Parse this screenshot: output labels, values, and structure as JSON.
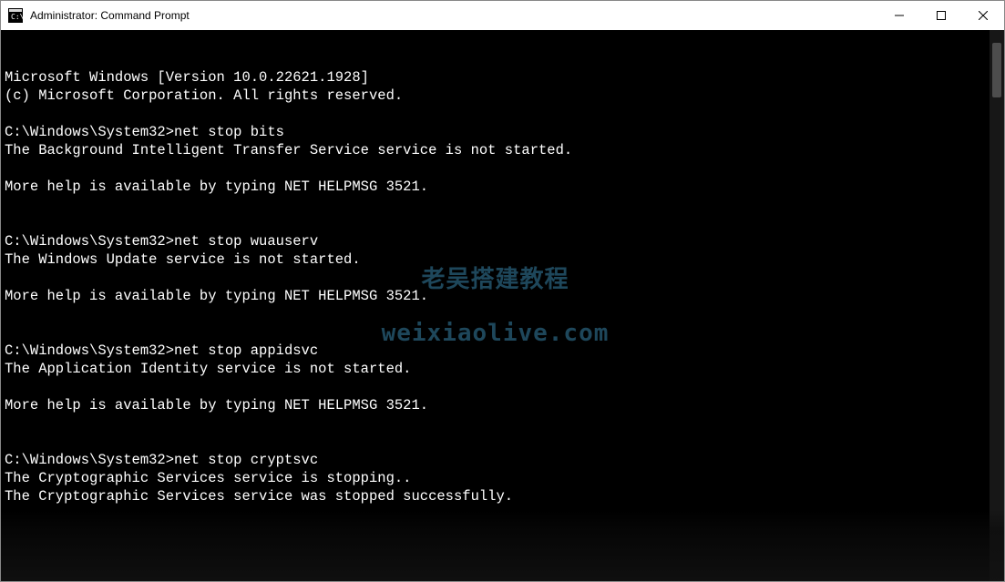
{
  "window": {
    "title": "Administrator: Command Prompt"
  },
  "terminal": {
    "lines": [
      "Microsoft Windows [Version 10.0.22621.1928]",
      "(c) Microsoft Corporation. All rights reserved.",
      "",
      "C:\\Windows\\System32>net stop bits",
      "The Background Intelligent Transfer Service service is not started.",
      "",
      "More help is available by typing NET HELPMSG 3521.",
      "",
      "",
      "C:\\Windows\\System32>net stop wuauserv",
      "The Windows Update service is not started.",
      "",
      "More help is available by typing NET HELPMSG 3521.",
      "",
      "",
      "C:\\Windows\\System32>net stop appidsvc",
      "The Application Identity service is not started.",
      "",
      "More help is available by typing NET HELPMSG 3521.",
      "",
      "",
      "C:\\Windows\\System32>net stop cryptsvc",
      "The Cryptographic Services service is stopping..",
      "The Cryptographic Services service was stopped successfully.",
      "",
      ""
    ]
  },
  "watermark": {
    "line1": "老吴搭建教程",
    "line2": "weixiaolive.com"
  }
}
